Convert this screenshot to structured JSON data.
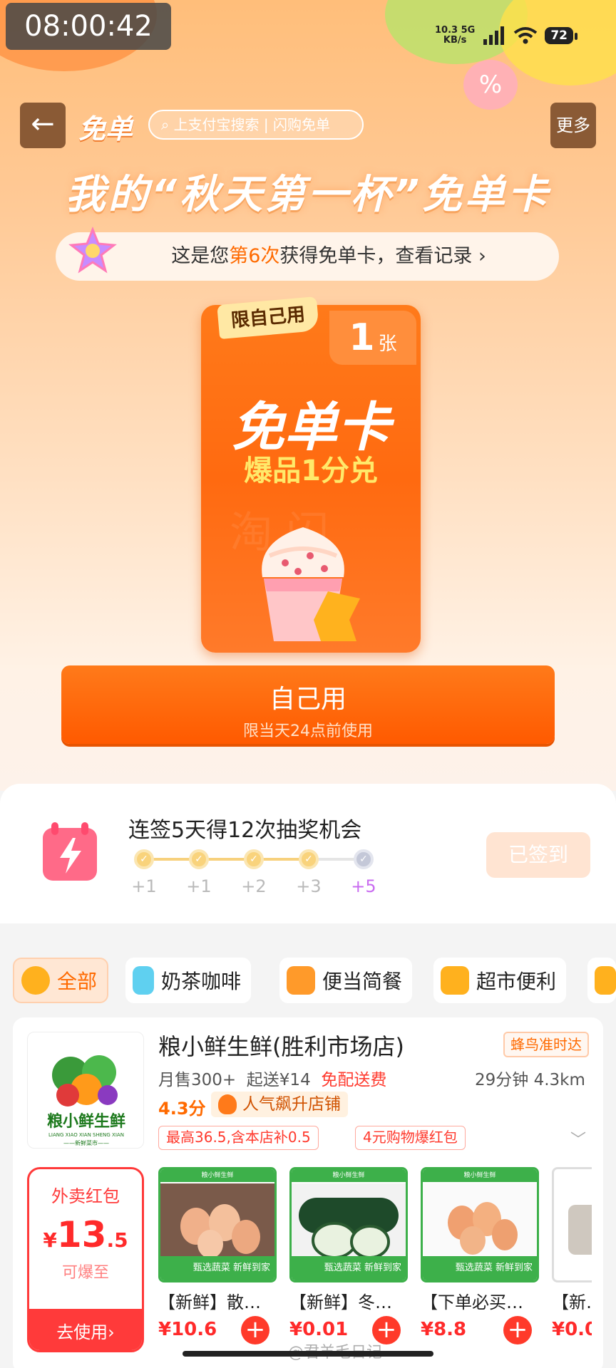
{
  "status_bar": {
    "time": "08:00:42",
    "net_speed_top": "10.3 5G",
    "net_speed_bottom": "KB/s",
    "battery": "72"
  },
  "header": {
    "back_icon": "arrow-left-icon",
    "brand": "免单",
    "search_placeholder": "上支付宝搜索 | 闪购免单",
    "more_label": "更多"
  },
  "hero": {
    "headline": "我的“秋天第一杯”免单卡",
    "record_prefix": "这是您",
    "record_count": "第6次",
    "record_suffix": "获得免单卡，查看记录 ›"
  },
  "card": {
    "tag": "限自己用",
    "count": "1",
    "count_unit": "张",
    "title": "免单卡",
    "subtitle": "爆品1分兑"
  },
  "use_button": {
    "label": "自己用",
    "sub": "限当天24点前使用"
  },
  "checkin": {
    "title": "连签5天得12次抽奖机会",
    "rewards": [
      "+1",
      "+1",
      "+2",
      "+3",
      "+5"
    ],
    "button": "已签到"
  },
  "categories": [
    {
      "label": "全部",
      "active": true
    },
    {
      "label": "奶茶咖啡",
      "active": false
    },
    {
      "label": "便当简餐",
      "active": false
    },
    {
      "label": "超市便利",
      "active": false
    }
  ],
  "store": {
    "name": "粮小鲜生鲜(胜利市场店)",
    "logo_text": "粮小鲜生鲜",
    "logo_pinyin": "LIANG XIAO XIAN SHENG XIAN",
    "logo_sub": "——新鲜菜市——",
    "delivery_badge": "蜂鸟准时达",
    "monthly_sales": "月售300+",
    "min_order": "起送¥14",
    "free_delivery": "免配送费",
    "time_distance": "29分钟 4.3km",
    "rating": "4.3分",
    "hot_tag": "人气飙升店铺",
    "coupon1": "最高36.5,含本店补0.5",
    "coupon2": "4元购物爆红包",
    "redpack": {
      "title": "外卖红包",
      "currency": "¥",
      "amount": "13",
      "amount_dec": ".5",
      "upgrade": "可爆至",
      "use": "去使用›"
    },
    "products": [
      {
        "name": "【新鲜】散…",
        "price": "¥10.6",
        "banner": "甄选蔬菜 新鲜到家",
        "top": "粮小鲜生鲜"
      },
      {
        "name": "【新鲜】冬…",
        "price": "¥0.01",
        "banner": "甄选蔬菜 新鲜到家",
        "top": "粮小鲜生鲜"
      },
      {
        "name": "【下单必买…",
        "price": "¥8.8",
        "banner": "甄选蔬菜 新鲜到家",
        "top": "粮小鲜生鲜"
      },
      {
        "name": "【新…",
        "price": "¥0.0",
        "banner": "",
        "top": ""
      }
    ]
  },
  "watermark": "@君羊毛日记",
  "colors": {
    "accent": "#ff6a00",
    "red": "#ff2a2a",
    "green": "#3db04a"
  }
}
